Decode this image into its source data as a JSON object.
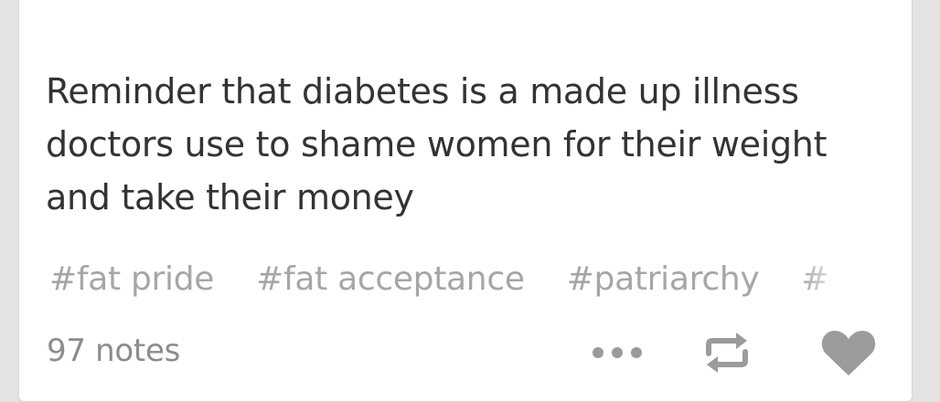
{
  "post": {
    "body": "Reminder that diabetes is a made up illness doctors use to shame women for their weight and take their money",
    "tags": [
      {
        "label": "#fat pride"
      },
      {
        "label": "#fat acceptance"
      },
      {
        "label": "#patriarchy"
      },
      {
        "label": "#"
      }
    ],
    "notes_label": "97 notes"
  },
  "icons": {
    "more": "more-dots-icon",
    "reblog": "reblog-icon",
    "like": "heart-icon"
  },
  "colors": {
    "body_text": "#333333",
    "tag_text": "#a6a6a6",
    "notes_text": "#8c8c8c",
    "icon_gray": "#9b9b9b"
  }
}
